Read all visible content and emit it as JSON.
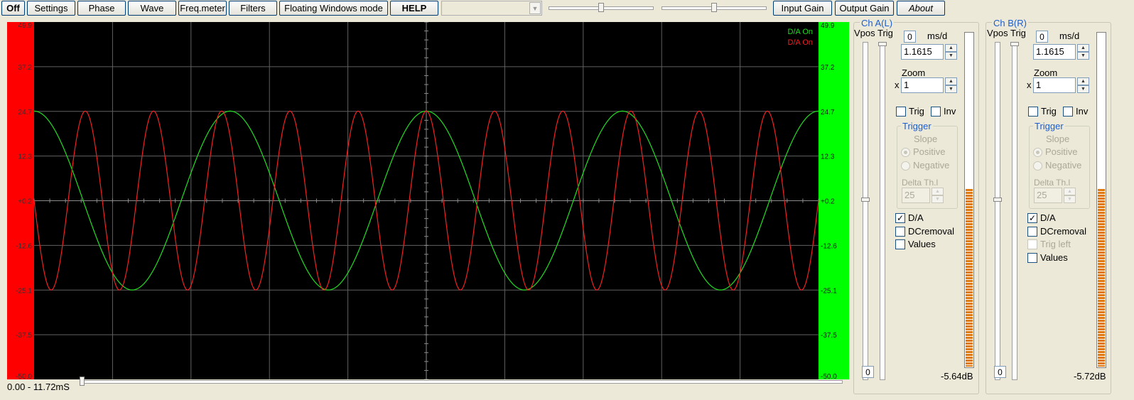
{
  "toolbar": {
    "off": "Off",
    "settings": "Settings",
    "phase": "Phase",
    "wave": "Wave",
    "freq_meter": "Freq.meter",
    "filters": "Filters",
    "floating": "Floating Windows mode",
    "help": "HELP",
    "input_gain": "Input Gain",
    "output_gain": "Output Gain",
    "about": "About",
    "combo_value": "",
    "slider1_level": 0.5,
    "slider2_level": 0.5
  },
  "scope": {
    "y_ticks_left": [
      "49.9",
      "37.2",
      "24.7",
      "12.3",
      "+0.2",
      "-12.6",
      "-25.1",
      "-37.5",
      "-50.0"
    ],
    "y_ticks_right": [
      "49.9",
      "37.2",
      "24.7",
      "12.3",
      "+0.2",
      "-12.6",
      "-25.1",
      "-37.5",
      "-50.0"
    ],
    "legend": [
      {
        "label": "D/A On",
        "color": "#22dd22"
      },
      {
        "label": "D/A On",
        "color": "#ee2222"
      }
    ],
    "left_bar_color": "#ff0000",
    "right_bar_color": "#00ff00",
    "background": "#000000",
    "grid_color": "#606060"
  },
  "chart_data": {
    "type": "line",
    "x_range": [
      0.0,
      11.72
    ],
    "ylim": [
      -50.0,
      49.9
    ],
    "amplitude": 25.0,
    "series": [
      {
        "color": "#22dd22",
        "cycles": 4.0,
        "phase_deg": 90,
        "amplitude": 25.0
      },
      {
        "color": "#ee2222",
        "cycles": 11.5,
        "phase_deg": 180,
        "amplitude": 25.0
      }
    ]
  },
  "time_range": "0.00 - 11.72mS",
  "channels": [
    {
      "title": "Ch A(L)",
      "vpos_trig": "Vpos Trig",
      "zero_btn": "0",
      "ms_per_div_label": "ms/d",
      "ms_per_div": "1.1615",
      "zoom_label": "Zoom",
      "x_label": "x",
      "zoom": "1",
      "trig": "Trig",
      "inv": "Inv",
      "trigger_title": "Trigger",
      "slope": "Slope",
      "positive": "Positive",
      "negative": "Negative",
      "delta_th": "Delta Th.l",
      "delta_value": "25",
      "da": "D/A",
      "dcremoval": "DCremoval",
      "trig_left": "",
      "values": "Values",
      "bottom_zero": "0",
      "db": "-5.64dB",
      "meter_level": 0.53
    },
    {
      "title": "Ch B(R)",
      "vpos_trig": "Vpos Trig",
      "zero_btn": "0",
      "ms_per_div_label": "ms/d",
      "ms_per_div": "1.1615",
      "zoom_label": "Zoom",
      "x_label": "x",
      "zoom": "1",
      "trig": "Trig",
      "inv": "Inv",
      "trigger_title": "Trigger",
      "slope": "Slope",
      "positive": "Positive",
      "negative": "Negative",
      "delta_th": "Delta Th.l",
      "delta_value": "25",
      "da": "D/A",
      "dcremoval": "DCremoval",
      "trig_left": "Trig left",
      "values": "Values",
      "bottom_zero": "0",
      "db": "-5.72dB",
      "meter_level": 0.53
    }
  ]
}
